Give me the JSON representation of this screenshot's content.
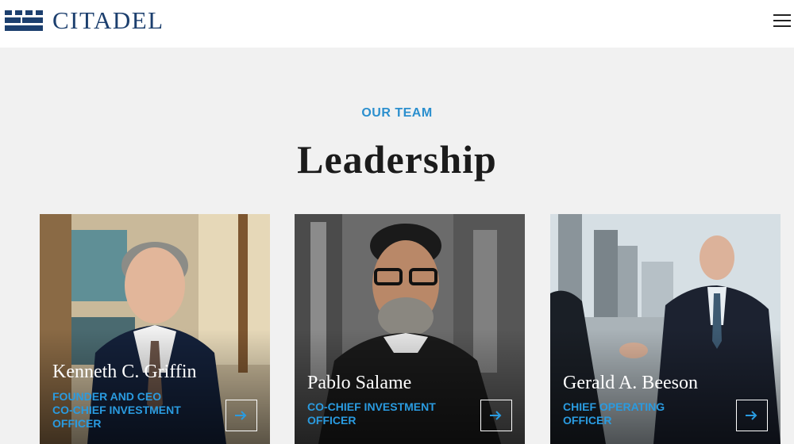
{
  "brand": {
    "name": "CITADEL",
    "color": "#1c3f6e"
  },
  "header": {
    "menu_icon": "hamburger-icon"
  },
  "section": {
    "eyebrow": "OUR TEAM",
    "title": "Leadership",
    "accent": "#2b8fce"
  },
  "leaders": [
    {
      "name": "Kenneth C. Griffin",
      "role": "FOUNDER AND CEO\nCO-CHIEF INVESTMENT OFFICER"
    },
    {
      "name": "Pablo Salame",
      "role": "CO-CHIEF INVESTMENT OFFICER"
    },
    {
      "name": "Gerald A. Beeson",
      "role": "CHIEF OPERATING OFFICER"
    }
  ]
}
